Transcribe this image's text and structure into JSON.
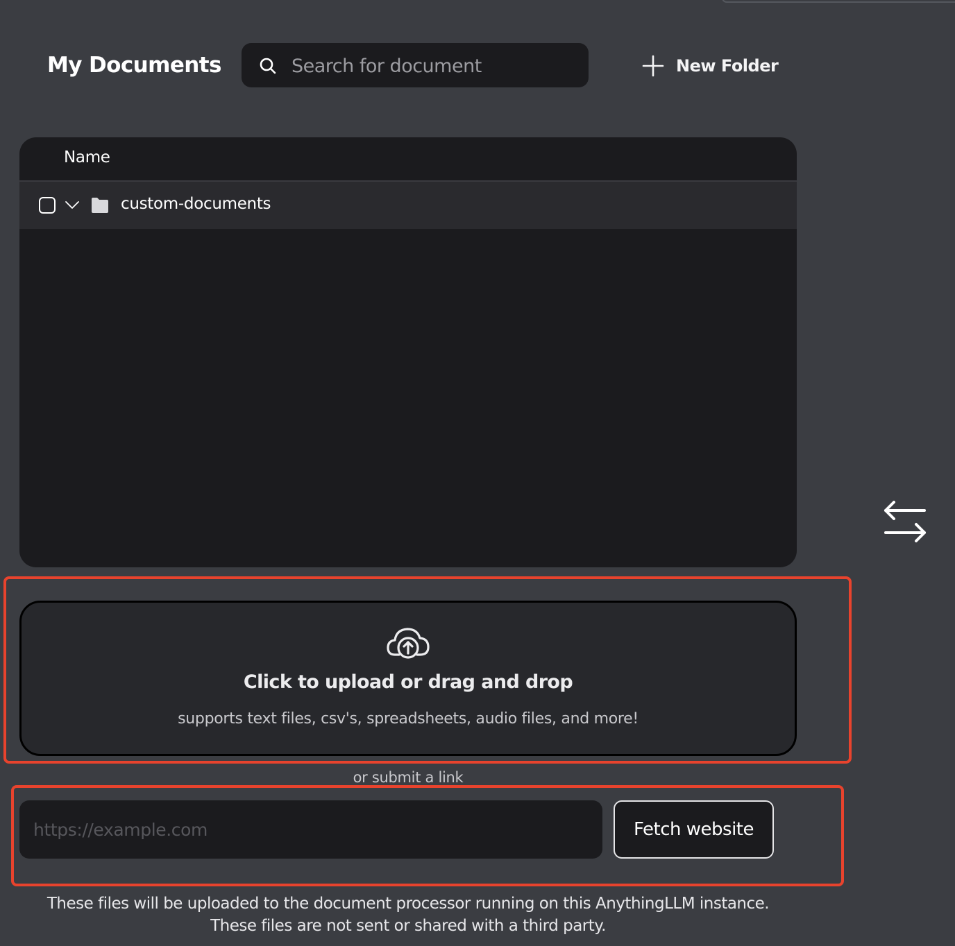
{
  "header": {
    "title": "My Documents",
    "search_placeholder": "Search for document",
    "new_folder_label": "New Folder"
  },
  "table": {
    "column_name": "Name",
    "rows": [
      {
        "name": "custom-documents",
        "type": "folder",
        "expanded": true,
        "checked": false
      }
    ]
  },
  "upload": {
    "title": "Click to upload or drag and drop",
    "subtitle": "supports text files, csv's, spreadsheets, audio files, and more!",
    "or_link_label": "or submit a link",
    "url_placeholder": "https://example.com",
    "fetch_button_label": "Fetch website"
  },
  "footer": {
    "line1": "These files will be uploaded to the document processor running on this AnythingLLM instance.",
    "line2": "These files are not sent or shared with a third party."
  },
  "icons": {
    "search": "search-icon",
    "new_folder": "plus-icon",
    "row_toggle": "chevron-down-icon",
    "folder": "folder-icon",
    "swap": "arrows-swap-icon",
    "upload": "cloud-upload-icon"
  },
  "colors": {
    "page_background": "#3b3d42",
    "panel_background": "#1b1b1e",
    "row_background": "#2a2a2e",
    "dropzone_background": "#27282c",
    "highlight_border": "#e8432d",
    "text_primary": "#ffffff"
  }
}
